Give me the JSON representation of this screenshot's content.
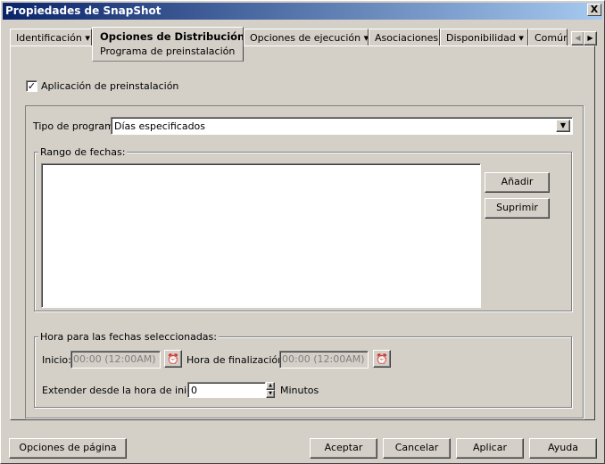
{
  "window": {
    "title": "Propiedades de SnapShot",
    "close_label": "X"
  },
  "tabs": [
    {
      "label": "Identificación ▾"
    },
    {
      "label": "Opciones de Distribución ▾",
      "active": true,
      "subpage": "Programa de preinstalación"
    },
    {
      "label": "Opciones de ejecución ▾"
    },
    {
      "label": "Asociaciones"
    },
    {
      "label": "Disponibilidad ▾"
    },
    {
      "label": "Común"
    }
  ],
  "tab_scroll": {
    "left": "◀",
    "right": "▶"
  },
  "form": {
    "apply_checkbox": {
      "label": "Aplicación de preinstalación",
      "checked": true
    },
    "schedule_type": {
      "label": "Tipo de programa:",
      "value": "Días especificados"
    },
    "date_range": {
      "legend": "Rango de fechas:",
      "items": [],
      "add_label": "Añadir",
      "delete_label": "Suprimir"
    },
    "time": {
      "legend": "Hora para las fechas seleccionadas:",
      "start_label": "Inicio:",
      "start_value": "00:00 (12:00AM)",
      "end_label": "Hora de finalización:",
      "end_value": "00:00 (12:00AM)",
      "extend_label": "Extender desde la hora de inicio:",
      "extend_value": "0",
      "extend_unit": "Minutos"
    }
  },
  "footer": {
    "page_options": "Opciones de página",
    "ok": "Aceptar",
    "cancel": "Cancelar",
    "apply": "Aplicar",
    "help": "Ayuda"
  }
}
